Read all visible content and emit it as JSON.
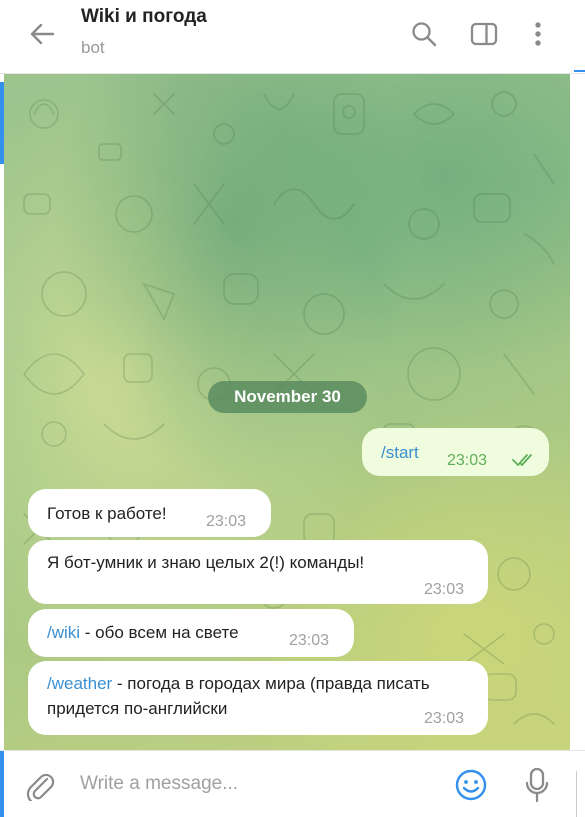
{
  "header": {
    "title": "Wiki и погода",
    "subtitle": "bot"
  },
  "chat": {
    "date_label": "November 30",
    "messages": [
      {
        "direction": "outgoing",
        "command": "/start",
        "text": "",
        "time": "23:03",
        "status": "read"
      },
      {
        "direction": "incoming",
        "command": "",
        "text": "Готов к работе!",
        "time": "23:03"
      },
      {
        "direction": "incoming",
        "command": "",
        "text": "Я бот-умник и знаю целых 2(!) команды!",
        "time": "23:03"
      },
      {
        "direction": "incoming",
        "command": "/wiki",
        "text": " - обо всем на свете",
        "time": "23:03"
      },
      {
        "direction": "incoming",
        "command": "/weather",
        "text": " - погода в городах мира (правда писать придется по-английски",
        "time": "23:03"
      }
    ]
  },
  "composer": {
    "placeholder": "Write a message...",
    "value": ""
  },
  "colors": {
    "accent": "#3390ec",
    "outgoing_bubble": "#effdde",
    "outgoing_meta": "#5eae5a",
    "command_link": "#3a8fd0",
    "date_pill": "#5a8c5f"
  },
  "icons": {
    "back": "arrow-left-icon",
    "search": "search-icon",
    "sidebar": "sidebar-toggle-icon",
    "menu": "more-vertical-icon",
    "attach": "paperclip-icon",
    "emoji": "smile-icon",
    "mic": "microphone-icon",
    "read_status": "double-check-icon"
  }
}
